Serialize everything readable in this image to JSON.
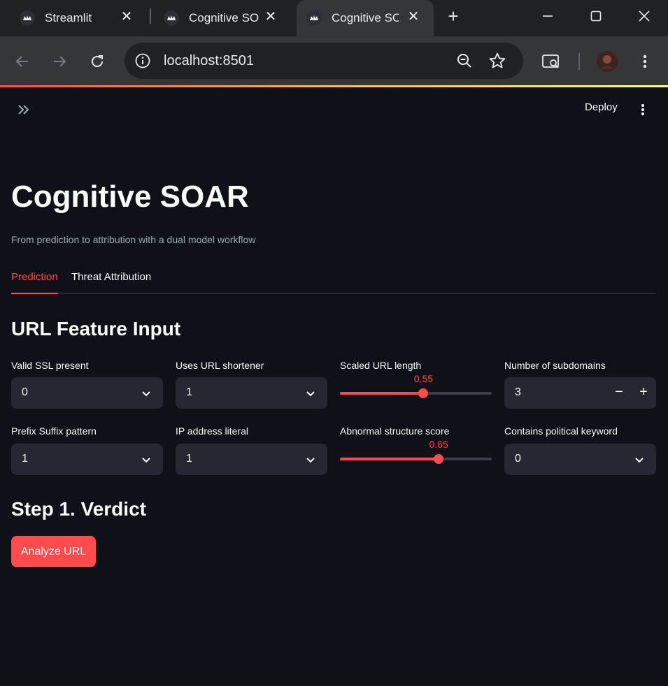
{
  "browser": {
    "tabs": [
      {
        "title": "Streamlit"
      },
      {
        "title": "Cognitive SOAR"
      },
      {
        "title": "Cognitive SOAR"
      }
    ],
    "url": "localhost:8501"
  },
  "colors": {
    "background": "#0e1117",
    "accent": "#ff4b4b",
    "input_bg": "#262730",
    "text": "#fafafa",
    "muted_text": "#a3a8b4"
  },
  "header": {
    "deploy_label": "Deploy"
  },
  "page": {
    "title": "Cognitive SOAR",
    "subtitle": "From prediction to attribution with a dual model workflow",
    "tabs": [
      {
        "label": "Prediction",
        "active": true
      },
      {
        "label": "Threat Attribution",
        "active": false
      }
    ]
  },
  "features": {
    "heading": "URL Feature Input",
    "ssl": {
      "label": "Valid SSL present",
      "value": "0"
    },
    "shortener": {
      "label": "Uses URL shortener",
      "value": "1"
    },
    "url_length": {
      "label": "Scaled URL length",
      "value": 0.55,
      "display": "0.55",
      "min": 0,
      "max": 1
    },
    "subdomains": {
      "label": "Number of subdomains",
      "value": "3"
    },
    "prefix_suffix": {
      "label": "Prefix Suffix pattern",
      "value": "1"
    },
    "ip_literal": {
      "label": "IP address literal",
      "value": "1"
    },
    "abnormal": {
      "label": "Abnormal structure score",
      "value": 0.65,
      "display": "0.65",
      "min": 0,
      "max": 1
    },
    "political": {
      "label": "Contains political keyword",
      "value": "0"
    }
  },
  "verdict": {
    "heading": "Step 1. Verdict",
    "button_label": "Analyze URL"
  },
  "icons": [
    "streamlit-favicon",
    "close-icon",
    "plus-icon",
    "minimize-icon",
    "maximize-icon",
    "back-arrow-icon",
    "forward-arrow-icon",
    "reload-icon",
    "info-icon",
    "zoom-icon",
    "star-icon",
    "tab-search-icon",
    "avatar",
    "kebab-menu-icon",
    "double-chevron-right-icon",
    "chevron-down-icon"
  ]
}
